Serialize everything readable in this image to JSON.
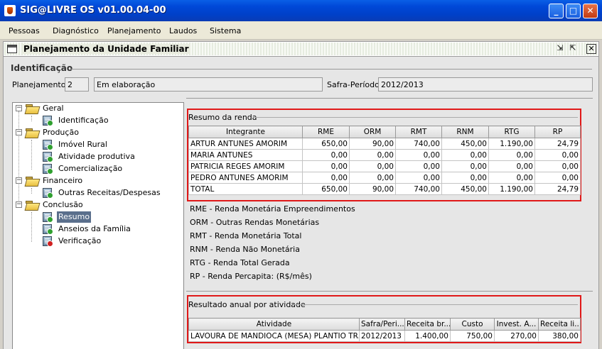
{
  "window": {
    "title": "SIG@LIVRE OS v01.00.04-00",
    "min_label": "_",
    "max_label": "□",
    "close_label": "✕"
  },
  "menu": [
    "Pessoas",
    "Diagnóstico",
    "Planejamento",
    "Laudos",
    "Sistema"
  ],
  "frame": {
    "title": "Planejamento da Unidade Familiar"
  },
  "identificacao": {
    "section_title": "Identificação",
    "planejamento_label": "Planejamento:",
    "planejamento_num": "2",
    "status": "Em elaboração",
    "safra_label": "Safra-Período:",
    "safra_value": "2012/2013"
  },
  "tree": {
    "geral": "Geral",
    "identificacao": "Identificação",
    "producao": "Produção",
    "imovel_rural": "Imóvel Rural",
    "atividade_produtiva": "Atividade produtiva",
    "comercializacao": "Comercialização",
    "financeiro": "Financeiro",
    "outras_receitas": "Outras Receitas/Despesas",
    "conclusao": "Conclusão",
    "resumo": "Resumo",
    "anseios": "Anseios da Família",
    "verificacao": "Verificação"
  },
  "resumo_renda": {
    "title": "Resumo da renda",
    "columns": [
      "Integrante",
      "RME",
      "ORM",
      "RMT",
      "RNM",
      "RTG",
      "RP"
    ],
    "rows": [
      [
        "ARTUR ANTUNES AMORIM",
        "650,00",
        "90,00",
        "740,00",
        "450,00",
        "1.190,00",
        "24,79"
      ],
      [
        "MARIA ANTUNES",
        "0,00",
        "0,00",
        "0,00",
        "0,00",
        "0,00",
        "0,00"
      ],
      [
        "PATRICIA REGES AMORIM",
        "0,00",
        "0,00",
        "0,00",
        "0,00",
        "0,00",
        "0,00"
      ],
      [
        "PEDRO ANTUNES AMORIM",
        "0,00",
        "0,00",
        "0,00",
        "0,00",
        "0,00",
        "0,00"
      ],
      [
        "TOTAL",
        "650,00",
        "90,00",
        "740,00",
        "450,00",
        "1.190,00",
        "24,79"
      ]
    ]
  },
  "legend": [
    "RME - Renda Monetária Empreendimentos",
    "ORM - Outras Rendas Monetárias",
    "RMT - Renda Monetária Total",
    "RNM - Renda Não Monetária",
    "RTG - Renda Total Gerada",
    "RP - Renda Percapita: (R$/mês)"
  ],
  "resultado_anual": {
    "title": "Resultado anual por atividade",
    "columns": [
      "Atividade",
      "Safra/Peri...",
      "Receita br...",
      "Custo",
      "Invest. A...",
      "Receita li..."
    ],
    "rows": [
      [
        "LAVOURA DE MANDIOCA (MESA) PLANTIO TR...",
        "2012/2013",
        "1.400,00",
        "750,00",
        "270,00",
        "380,00"
      ]
    ]
  }
}
